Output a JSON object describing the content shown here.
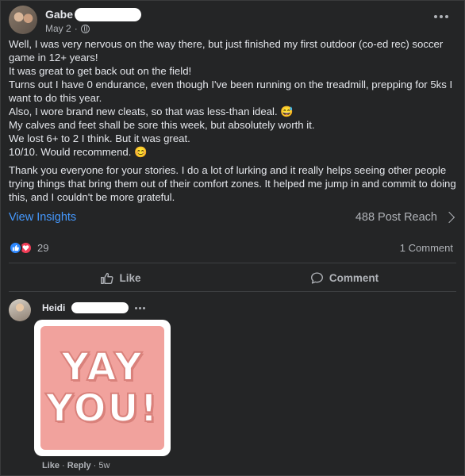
{
  "post": {
    "author": "Gabe",
    "date": "May 2",
    "separator": "·",
    "body_lines": [
      "Well, I was very nervous on the way there, but just finished my first outdoor (co-ed rec) soccer game in 12+ years!",
      "It was great to get back out on the field!",
      "Turns out I have 0 endurance, even though I've been running on the treadmill, prepping for 5ks I want to do this year.",
      "Also, I wore brand new cleats, so that was less-than ideal. 😅",
      "My calves and feet shall be sore this week, but absolutely worth it.",
      "We lost 6+ to 2 I think. But it was great.",
      "10/10. Would recommend. 😊"
    ],
    "body_paragraph2": "Thank you everyone for your stories. I do a lot of lurking and it really helps seeing other people trying things that bring them out of their comfort zones. It helped me jump in and commit to doing this, and I couldn't be more grateful.",
    "view_insights": "View Insights",
    "post_reach": "488 Post Reach",
    "reaction_count": "29",
    "comment_count": "1 Comment",
    "like_label": "Like",
    "comment_label": "Comment"
  },
  "comment": {
    "author": "Heidi",
    "sticker_line1": "YAY",
    "sticker_line2": "YOU!",
    "like_label": "Like",
    "separator": "·",
    "reply_label": "Reply",
    "time": "5w"
  },
  "colors": {
    "background": "#242526",
    "link": "#4599ff",
    "like_reaction": "#2d88ff",
    "love_reaction": "#f33e58",
    "sticker_pink": "#f1a29d"
  },
  "icons": [
    "globe-icon",
    "more-icon",
    "chevron-right-icon",
    "like-reaction-icon",
    "love-reaction-icon",
    "thumbs-up-icon",
    "comment-icon"
  ]
}
